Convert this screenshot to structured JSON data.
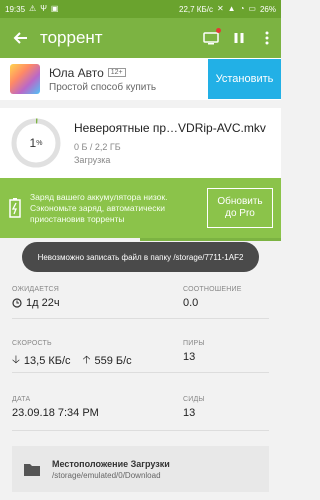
{
  "status_bar": {
    "time": "19:35",
    "network_speed": "22,7 КБ/с",
    "battery": "26%"
  },
  "toolbar": {
    "title": "торрент"
  },
  "ad": {
    "title": "Юла Авто",
    "age_rating": "12+",
    "subtitle": "Простой способ купить",
    "button_label": "Установить"
  },
  "torrent": {
    "progress_percent": 1,
    "progress_label": "1",
    "percent_sign": "%",
    "name": "Невероятные пр…VDRip-AVC.mkv",
    "size": "0 Б / 2,2 ГБ",
    "status": "Загрузка"
  },
  "battery_banner": {
    "line1": "Заряд вашего аккумулятора низок.",
    "line2": "Сэкономьте заряд, автоматически",
    "line3": "приостановив торренты",
    "button_line1": "Обновить",
    "button_line2": "до Pro"
  },
  "toast": {
    "message": "Невозможно записать файл в папку /storage/7711-1AF2"
  },
  "details": {
    "eta_label": "ОЖИДАЕТСЯ",
    "eta_value": "1д 22ч",
    "ratio_label": "СООТНОШЕНИЕ",
    "ratio_value": "0.0",
    "speed_label": "СКОРОСТЬ",
    "download_speed": "13,5 КБ/с",
    "upload_speed": "559 Б/с",
    "peers_label": "ПИРЫ",
    "peers_value": "13",
    "date_label": "ДАТА",
    "date_value": "23.09.18 7:34 PM",
    "seeds_label": "СИДЫ",
    "seeds_value": "13"
  },
  "location": {
    "title": "Местоположение Загрузки",
    "path": "/storage/emulated/0/Download"
  },
  "colors": {
    "toolbar": "#7cb342",
    "banner": "#8bc34a",
    "ad_button": "#22b0e6"
  }
}
